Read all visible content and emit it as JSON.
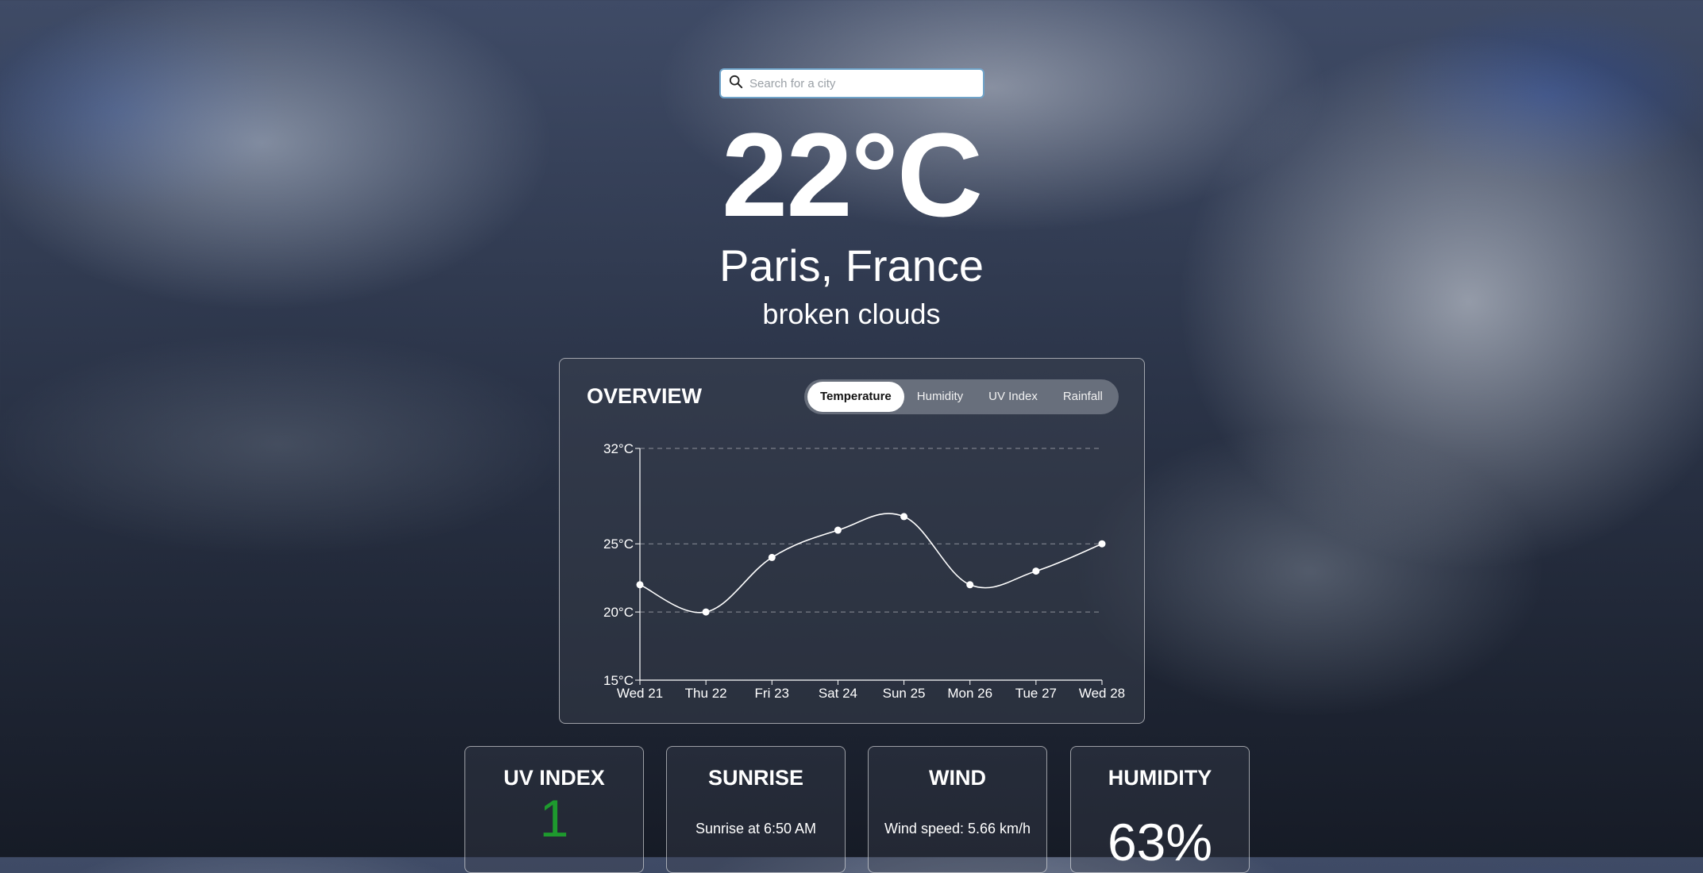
{
  "search": {
    "placeholder": "Search for a city"
  },
  "current": {
    "temperature": "22°C",
    "location": "Paris, France",
    "description": "broken clouds"
  },
  "overview": {
    "title": "OVERVIEW",
    "tabs": [
      {
        "label": "Temperature",
        "active": true
      },
      {
        "label": "Humidity",
        "active": false
      },
      {
        "label": "UV Index",
        "active": false
      },
      {
        "label": "Rainfall",
        "active": false
      }
    ]
  },
  "chart_data": {
    "type": "line",
    "x": [
      "Wed 21",
      "Thu 22",
      "Fri 23",
      "Sat 24",
      "Sun 25",
      "Mon 26",
      "Tue 27",
      "Wed 28"
    ],
    "series": [
      {
        "values": [
          22,
          20,
          24,
          26,
          27,
          22,
          23,
          25
        ]
      }
    ],
    "yticks": [
      "15°C",
      "20°C",
      "25°C",
      "32°C"
    ],
    "ytick_values": [
      15,
      20,
      25,
      32
    ],
    "ylim": [
      15,
      32
    ],
    "grid": "dashed at 20, 25, 32"
  },
  "cards": {
    "uv": {
      "title": "UV INDEX",
      "value": "1",
      "color": "#1e9a2e"
    },
    "sunrise": {
      "title": "SUNRISE",
      "text": "Sunrise at 6:50 AM"
    },
    "wind": {
      "title": "WIND",
      "text": "Wind speed: 5.66 km/h"
    },
    "humidity": {
      "title": "HUMIDITY",
      "value": "63%"
    }
  }
}
